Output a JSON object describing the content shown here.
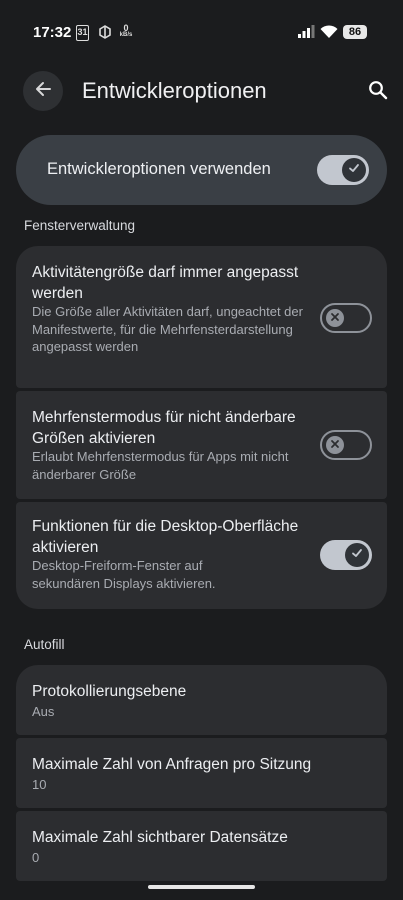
{
  "status_bar": {
    "time": "17:32",
    "calendar_day": "31",
    "speed_value": "0",
    "speed_unit": "kB/s",
    "battery": "86"
  },
  "header": {
    "title": "Entwickleroptionen"
  },
  "master_toggle": {
    "label": "Entwickleroptionen verwenden",
    "state": "on"
  },
  "sections": {
    "window": "Fensterverwaltung",
    "autofill": "Autofill"
  },
  "window_items": [
    {
      "title": "Aktivitätengröße darf immer angepasst werden",
      "subtitle": "Die Größe aller Aktivitäten darf, ungeachtet der Manifestwerte, für die Mehrfensterdarstellung angepasst werden",
      "state": "off"
    },
    {
      "title": "Mehrfenstermodus für nicht änderbare Größen aktivieren",
      "subtitle": "Erlaubt Mehrfenstermodus für Apps mit nicht änderbarer Größe",
      "state": "off"
    },
    {
      "title": "Funktionen für die Desktop-Oberfläche aktivieren",
      "subtitle": "Desktop-Freiform-Fenster auf sekundären Displays aktivieren.",
      "state": "on"
    }
  ],
  "autofill_items": [
    {
      "title": "Protokollierungsebene",
      "value": "Aus"
    },
    {
      "title": "Maximale Zahl von Anfragen pro Sitzung",
      "value": "10"
    },
    {
      "title": "Maximale Zahl sichtbarer Datensätze",
      "value": "0"
    }
  ],
  "colors": {
    "background": "#1b1c1e",
    "card": "#2c2d30",
    "master": "#3a3f45",
    "toggle_on": "#c2c7cf"
  }
}
